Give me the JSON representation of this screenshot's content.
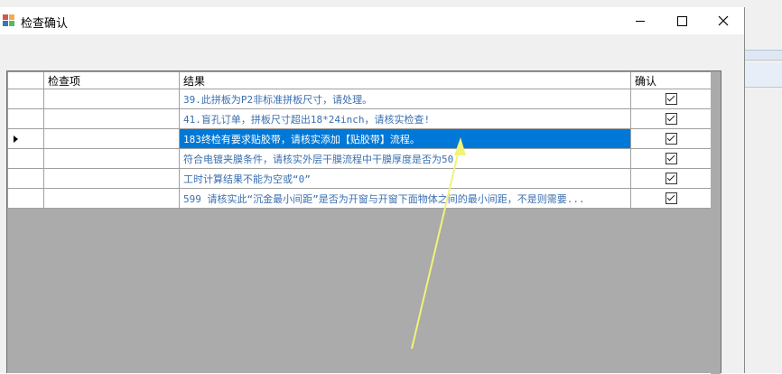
{
  "window": {
    "title": "检查确认"
  },
  "grid": {
    "columns": [
      "检查项",
      "结果",
      "确认"
    ],
    "rows": [
      {
        "item": "",
        "result": "39.此拼板为P2非标准拼板尺寸，请处理。",
        "confirmed": true
      },
      {
        "item": "",
        "result": "41.盲孔订单，拼板尺寸超出18*24inch，请核实检查!",
        "confirmed": true
      },
      {
        "item": "",
        "result": "183终检有要求贴胶带，请核实添加【贴胶带】流程。",
        "confirmed": true
      },
      {
        "item": "",
        "result": "符合电镀夹膜条件，请核实外层干膜流程中干膜厚度是否为50",
        "confirmed": true
      },
      {
        "item": "",
        "result": "工时计算结果不能为空或“0”",
        "confirmed": true
      },
      {
        "item": "",
        "result": "599 请核实此“沉金最小间距”是否为开窗与开窗下面物体之间的最小间距，不是则需要...",
        "confirmed": true
      }
    ],
    "selected_row": 2
  },
  "colors": {
    "selection": "#0078d7",
    "result_text": "#3b6fb0",
    "grid_background": "#ababab",
    "annotation_arrow": "#f2f27a"
  },
  "icons": {
    "app": "app-grid-icon",
    "minimize": "minimize-icon",
    "maximize": "maximize-icon",
    "close": "close-icon",
    "row_pointer": "row-pointer-icon",
    "checkbox": "checkbox-checked-icon"
  }
}
